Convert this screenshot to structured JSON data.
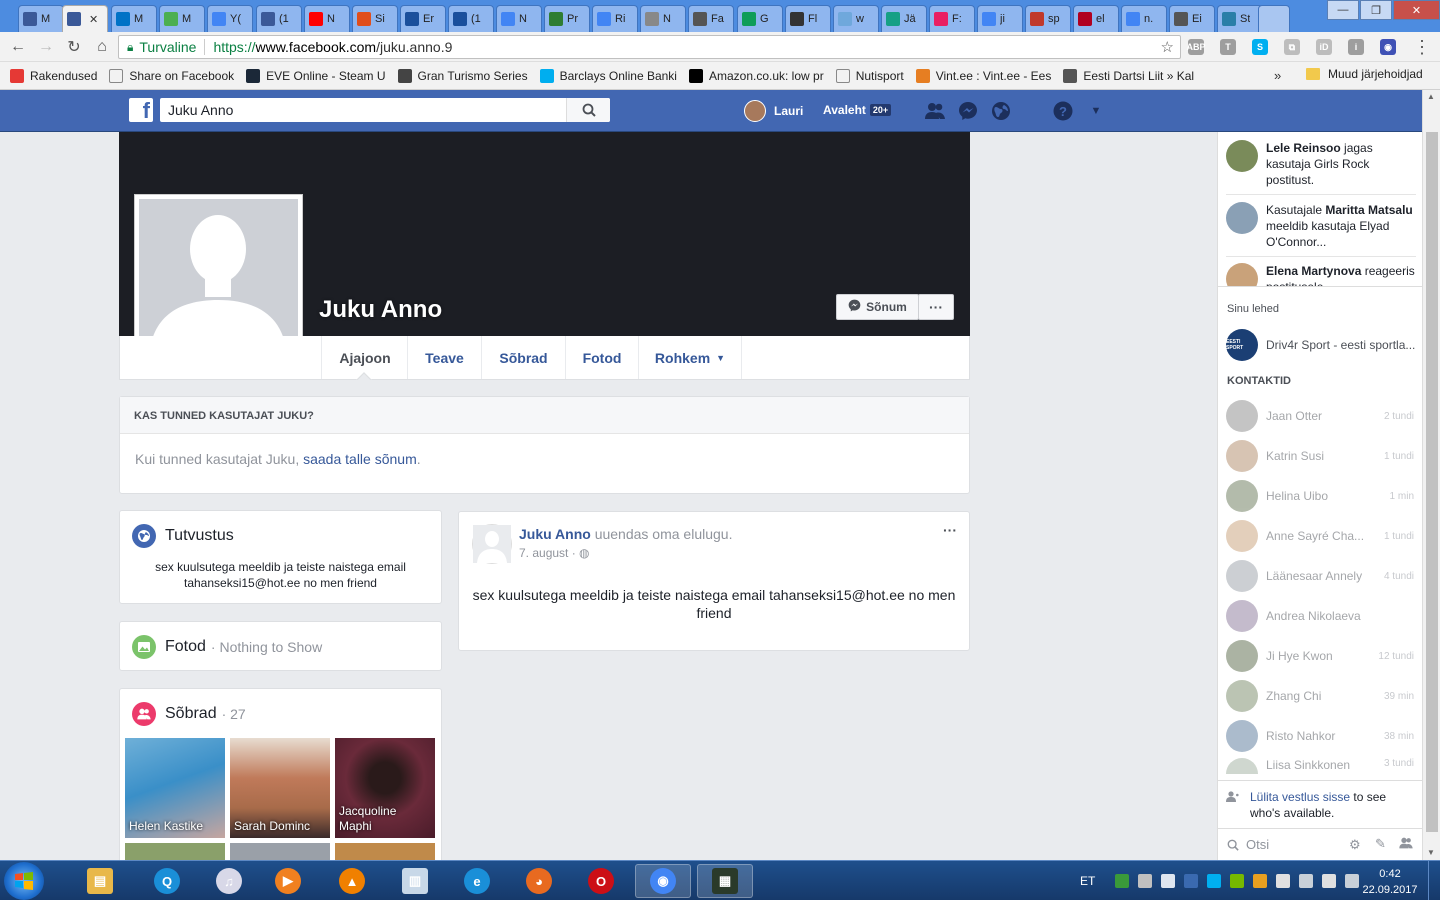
{
  "browser": {
    "tabs": [
      {
        "title": "M",
        "color": "#3b5998"
      },
      {
        "title": "",
        "color": "#3b5998",
        "active": true
      },
      {
        "title": "M",
        "color": "#0072c6"
      },
      {
        "title": "M",
        "color": "#4caf50"
      },
      {
        "title": "Y(",
        "color": "#4285f4"
      },
      {
        "title": "(1",
        "color": "#3b5998"
      },
      {
        "title": "N",
        "color": "#ff0000"
      },
      {
        "title": "Si",
        "color": "#e04e1b"
      },
      {
        "title": "Er",
        "color": "#1a4f9c"
      },
      {
        "title": "(1",
        "color": "#1a4f9c"
      },
      {
        "title": "N",
        "color": "#4285f4"
      },
      {
        "title": "Pr",
        "color": "#2e7d32"
      },
      {
        "title": "Ri",
        "color": "#4285f4"
      },
      {
        "title": "N",
        "color": "#888888"
      },
      {
        "title": "Fa",
        "color": "#555555"
      },
      {
        "title": "G",
        "color": "#0f9d58"
      },
      {
        "title": "Fl",
        "color": "#333333"
      },
      {
        "title": "w",
        "color": "#6fa8dc"
      },
      {
        "title": "Jä",
        "color": "#16a085"
      },
      {
        "title": "F:",
        "color": "#e91e63"
      },
      {
        "title": "ji",
        "color": "#4285f4"
      },
      {
        "title": "sp",
        "color": "#c0392b"
      },
      {
        "title": "el",
        "color": "#b00020"
      },
      {
        "title": "n.",
        "color": "#4285f4"
      },
      {
        "title": "Ei",
        "color": "#555555"
      },
      {
        "title": "St",
        "color": "#2a7fa8"
      }
    ],
    "window_controls": {
      "minimize": "—",
      "maximize": "❐",
      "close": "✕"
    },
    "secure_label": "Turvaline",
    "url_scheme": "https://",
    "url_host": "www.facebook.com",
    "url_path": "/juku.anno.9",
    "extensions": [
      {
        "name": "abp-icon",
        "label": "ABP",
        "color": "#9e9e9e"
      },
      {
        "name": "t-icon",
        "label": "T",
        "color": "#9e9e9e"
      },
      {
        "name": "skype-icon",
        "label": "S",
        "color": "#00aff0"
      },
      {
        "name": "pdf-icon",
        "label": "⧉",
        "color": "#bdbdbd"
      },
      {
        "name": "id-icon",
        "label": "iD",
        "color": "#bdbdbd"
      },
      {
        "name": "info-icon",
        "label": "i",
        "color": "#9e9e9e"
      },
      {
        "name": "chrome-ext-icon",
        "label": "◉",
        "color": "#3f51b5"
      }
    ],
    "menu_icon": "⋮",
    "bookmarks": [
      {
        "label": "Rakendused",
        "icon": "apps-icon",
        "color": "#e53935"
      },
      {
        "label": "Share on Facebook",
        "icon": "page-icon",
        "color": "#888888"
      },
      {
        "label": "EVE Online - Steam U",
        "icon": "steam-icon",
        "color": "#1b2838"
      },
      {
        "label": "Gran Turismo Series",
        "icon": "gt-icon",
        "color": "#444444"
      },
      {
        "label": "Barclays Online Banki",
        "icon": "barclays-icon",
        "color": "#00aeef"
      },
      {
        "label": "Amazon.co.uk: low pr",
        "icon": "amazon-icon",
        "color": "#000000"
      },
      {
        "label": "Nutisport",
        "icon": "page-icon",
        "color": "#888888"
      },
      {
        "label": "Vint.ee : Vint.ee - Ees",
        "icon": "vint-icon",
        "color": "#e67e22"
      },
      {
        "label": "Eesti Dartsi Liit »  Kal",
        "icon": "darts-icon",
        "color": "#555555"
      }
    ],
    "bookmarks_more": "»",
    "other_bookmarks": "Muud järjehoidjad"
  },
  "fb": {
    "logo": "f",
    "search_value": "Juku Anno",
    "user_name": "Lauri",
    "home_label": "Avaleht",
    "home_badge": "20+"
  },
  "profile": {
    "name": "Juku Anno",
    "message_button": "Sõnum",
    "more_button": "···",
    "tabs": [
      "Ajajoon",
      "Teave",
      "Sõbrad",
      "Fotod",
      "Rohkem"
    ],
    "tabs_caret": "▼"
  },
  "know_box": {
    "title": "KAS TUNNED KASUTAJAT JUKU?",
    "body_prefix": "Kui tunned kasutajat Juku, ",
    "body_link": "saada talle sõnum",
    "body_suffix": "."
  },
  "intro": {
    "title": "Tutvustus",
    "text": "sex kuulsutega meeldib ja teiste naistega email tahanseksi15@hot.ee no men friend"
  },
  "photos": {
    "title": "Fotod",
    "subtitle": "· Nothing to Show"
  },
  "friends": {
    "title": "Sõbrad",
    "count": "· 27",
    "items": [
      {
        "name": "Helen Kastike",
        "color": "#3a8fc8"
      },
      {
        "name": "Sarah Dominc",
        "color": "#a86b4a"
      },
      {
        "name": "Jacquoline Maphi",
        "color": "#4a1c2a"
      }
    ]
  },
  "post": {
    "author": "Juku Anno",
    "action": " uuendas oma elulugu.",
    "date": "7. august",
    "date_sep": " · ",
    "privacy_icon": "◍",
    "menu": "···",
    "body": "sex kuulsutega meeldib ja teiste naistega email tahanseksi15@hot.ee no men friend"
  },
  "sidebar": {
    "ticker": [
      {
        "bold": "Lele Reinsoo",
        "text": " jagas kasutaja Girls Rock postitust.",
        "color": "#7a8b5a"
      },
      {
        "pre": "Kasutajale ",
        "bold": "Maritta Matsalu",
        "text": " meeldib kasutaja Elyad O'Connor...",
        "color": "#8aa0b5"
      },
      {
        "bold": "Elena Martynova",
        "text": " reageeris postitusele",
        "color": "#c9a27a"
      }
    ],
    "pages_heading": "Sinu lehed",
    "page": {
      "name": "Driv4r Sport - eesti sportla...",
      "color": "#1b3f74",
      "logo_text": "EESTI SPORT"
    },
    "contacts_heading": "KONTAKTID",
    "contacts": [
      {
        "name": "Jaan Otter",
        "time": "2 tundi",
        "color": "#8a8a8a"
      },
      {
        "name": "Katrin Susi",
        "time": "1 tundi",
        "color": "#b08a6a"
      },
      {
        "name": "Helina Uibo",
        "time": "1 min",
        "color": "#6a7a5a"
      },
      {
        "name": "Anne Sayré Cha...",
        "time": "1 tundi",
        "color": "#c9a07a"
      },
      {
        "name": "Läänesaar Annely",
        "time": "4 tundi",
        "color": "#9aa0a8"
      },
      {
        "name": "Andrea Nikolaeva",
        "time": "",
        "color": "#8a7a9a"
      },
      {
        "name": "Ji Hye Kwon",
        "time": "12 tundi",
        "color": "#5a6a4a"
      },
      {
        "name": "Zhang Chi",
        "time": "39 min",
        "color": "#7a8a6a"
      },
      {
        "name": "Risto Nahkor",
        "time": "38 min",
        "color": "#5a7a9a"
      },
      {
        "name": "Liisa Sinkkonen",
        "time": "3 tundi",
        "color": "#a0b0a0"
      }
    ],
    "chat_footer_link": "Lülita vestlus sisse",
    "chat_footer_text": " to see who's available.",
    "search_placeholder": "Otsi"
  },
  "taskbar": {
    "apps": [
      {
        "name": "explorer",
        "color": "#e8b84a",
        "glyph": "▤"
      },
      {
        "name": "q-app",
        "color": "#1a8fd8",
        "glyph": "Q"
      },
      {
        "name": "itunes",
        "color": "#d8d8e8",
        "glyph": "♫"
      },
      {
        "name": "media-player",
        "color": "#f08020",
        "glyph": "▶"
      },
      {
        "name": "vlc",
        "color": "#f08000",
        "glyph": "▲"
      },
      {
        "name": "notepad-app",
        "color": "#c8d8e8",
        "glyph": "▥"
      },
      {
        "name": "ie",
        "color": "#1a8fd8",
        "glyph": "e"
      },
      {
        "name": "firefox",
        "color": "#e86a20",
        "glyph": "◕"
      },
      {
        "name": "opera",
        "color": "#cc0f16",
        "glyph": "O"
      },
      {
        "name": "chrome",
        "color": "#4285f4",
        "glyph": "◉"
      },
      {
        "name": "terminal",
        "color": "#2a3a2a",
        "glyph": "▦"
      }
    ],
    "language": "ET",
    "time": "0:42",
    "date": "22.09.2017"
  }
}
